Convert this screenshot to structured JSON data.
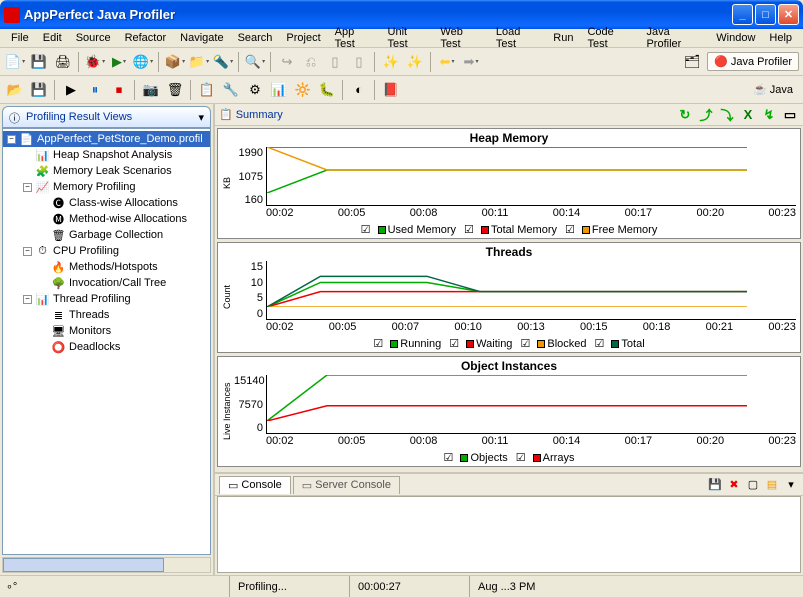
{
  "window": {
    "title": "AppPerfect Java Profiler"
  },
  "menu": [
    "File",
    "Edit",
    "Source",
    "Refactor",
    "Navigate",
    "Search",
    "Project",
    "App Test",
    "Unit Test",
    "Web Test",
    "Load Test",
    "Run",
    "Code Test",
    "Java Profiler",
    "Window",
    "Help"
  ],
  "perspectives": {
    "active": "Java Profiler",
    "other": "Java"
  },
  "sidebar": {
    "title": "Profiling Result Views",
    "root": "AppPerfect_PetStore_Demo.profil",
    "items": [
      {
        "label": "Heap Snapshot Analysis",
        "indent": 1,
        "icon": "📊",
        "twist": "none"
      },
      {
        "label": "Memory Leak Scenarios",
        "indent": 1,
        "icon": "🧩",
        "twist": "none"
      },
      {
        "label": "Memory Profiling",
        "indent": 1,
        "icon": "📈",
        "twist": "minus"
      },
      {
        "label": "Class-wise Allocations",
        "indent": 2,
        "icon": "🅒",
        "twist": "none"
      },
      {
        "label": "Method-wise Allocations",
        "indent": 2,
        "icon": "🅜",
        "twist": "none"
      },
      {
        "label": "Garbage Collection",
        "indent": 2,
        "icon": "🗑",
        "twist": "none"
      },
      {
        "label": "CPU Profiling",
        "indent": 1,
        "icon": "⏱",
        "twist": "minus"
      },
      {
        "label": "Methods/Hotspots",
        "indent": 2,
        "icon": "🔥",
        "twist": "none"
      },
      {
        "label": "Invocation/Call Tree",
        "indent": 2,
        "icon": "🌳",
        "twist": "none"
      },
      {
        "label": "Thread Profiling",
        "indent": 1,
        "icon": "📊",
        "twist": "minus"
      },
      {
        "label": "Threads",
        "indent": 2,
        "icon": "≣",
        "twist": "none"
      },
      {
        "label": "Monitors",
        "indent": 2,
        "icon": "🖥",
        "twist": "none"
      },
      {
        "label": "Deadlocks",
        "indent": 2,
        "icon": "⭕",
        "twist": "none"
      }
    ]
  },
  "summary": {
    "title": "Summary"
  },
  "chart_data": [
    {
      "type": "line",
      "title": "Heap Memory",
      "ylabel": "KB",
      "yticks": [
        160,
        1075,
        1990
      ],
      "xticks": [
        "00:02",
        "00:05",
        "00:08",
        "00:11",
        "00:14",
        "00:17",
        "00:20",
        "00:23"
      ],
      "series": [
        {
          "name": "Used Memory",
          "color": "#0a0",
          "values": [
            160,
            1075,
            1075,
            1075,
            1075,
            1075,
            1075,
            1075,
            1075
          ]
        },
        {
          "name": "Total Memory",
          "color": "#e00",
          "values": [
            1990,
            1990,
            1990,
            1990,
            1990,
            1990,
            1990,
            1990,
            1990
          ]
        },
        {
          "name": "Free Memory",
          "color": "#e90",
          "values": [
            1990,
            1075,
            1075,
            1075,
            1075,
            1075,
            1075,
            1075,
            1075
          ]
        }
      ],
      "ylim": [
        160,
        1990
      ]
    },
    {
      "type": "line",
      "title": "Threads",
      "ylabel": "Count",
      "yticks": [
        0,
        5,
        10,
        15
      ],
      "xticks": [
        "00:02",
        "00:05",
        "00:07",
        "00:10",
        "00:13",
        "00:15",
        "00:18",
        "00:21",
        "00:23"
      ],
      "series": [
        {
          "name": "Running",
          "color": "#0a0",
          "values": [
            0,
            8,
            8,
            8,
            5,
            5,
            5,
            5,
            5,
            5
          ]
        },
        {
          "name": "Waiting",
          "color": "#e00",
          "values": [
            0,
            5,
            5,
            5,
            5,
            5,
            5,
            5,
            5,
            5
          ]
        },
        {
          "name": "Blocked",
          "color": "#e90",
          "values": [
            0,
            0,
            0,
            0,
            0,
            0,
            0,
            0,
            0,
            0
          ]
        },
        {
          "name": "Total",
          "color": "#064",
          "values": [
            0,
            10,
            10,
            10,
            5,
            5,
            5,
            5,
            5,
            5
          ]
        }
      ],
      "ylim": [
        0,
        15
      ]
    },
    {
      "type": "line",
      "title": "Object Instances",
      "ylabel": "Live Instances",
      "yticks": [
        0,
        7570,
        15140
      ],
      "xticks": [
        "00:02",
        "00:05",
        "00:08",
        "00:11",
        "00:14",
        "00:17",
        "00:20",
        "00:23"
      ],
      "series": [
        {
          "name": "Objects",
          "color": "#0a0",
          "values": [
            0,
            15140,
            15140,
            15140,
            15140,
            15140,
            15140,
            15140,
            15140
          ]
        },
        {
          "name": "Arrays",
          "color": "#e00",
          "values": [
            0,
            5000,
            5000,
            5000,
            5000,
            5000,
            5000,
            5000,
            5000
          ]
        }
      ],
      "ylim": [
        0,
        15140
      ]
    }
  ],
  "console": {
    "tab1": "Console",
    "tab2": "Server Console"
  },
  "status": {
    "state": "Profiling...",
    "elapsed": "00:00:27",
    "datetime": "Aug ...3 PM"
  }
}
